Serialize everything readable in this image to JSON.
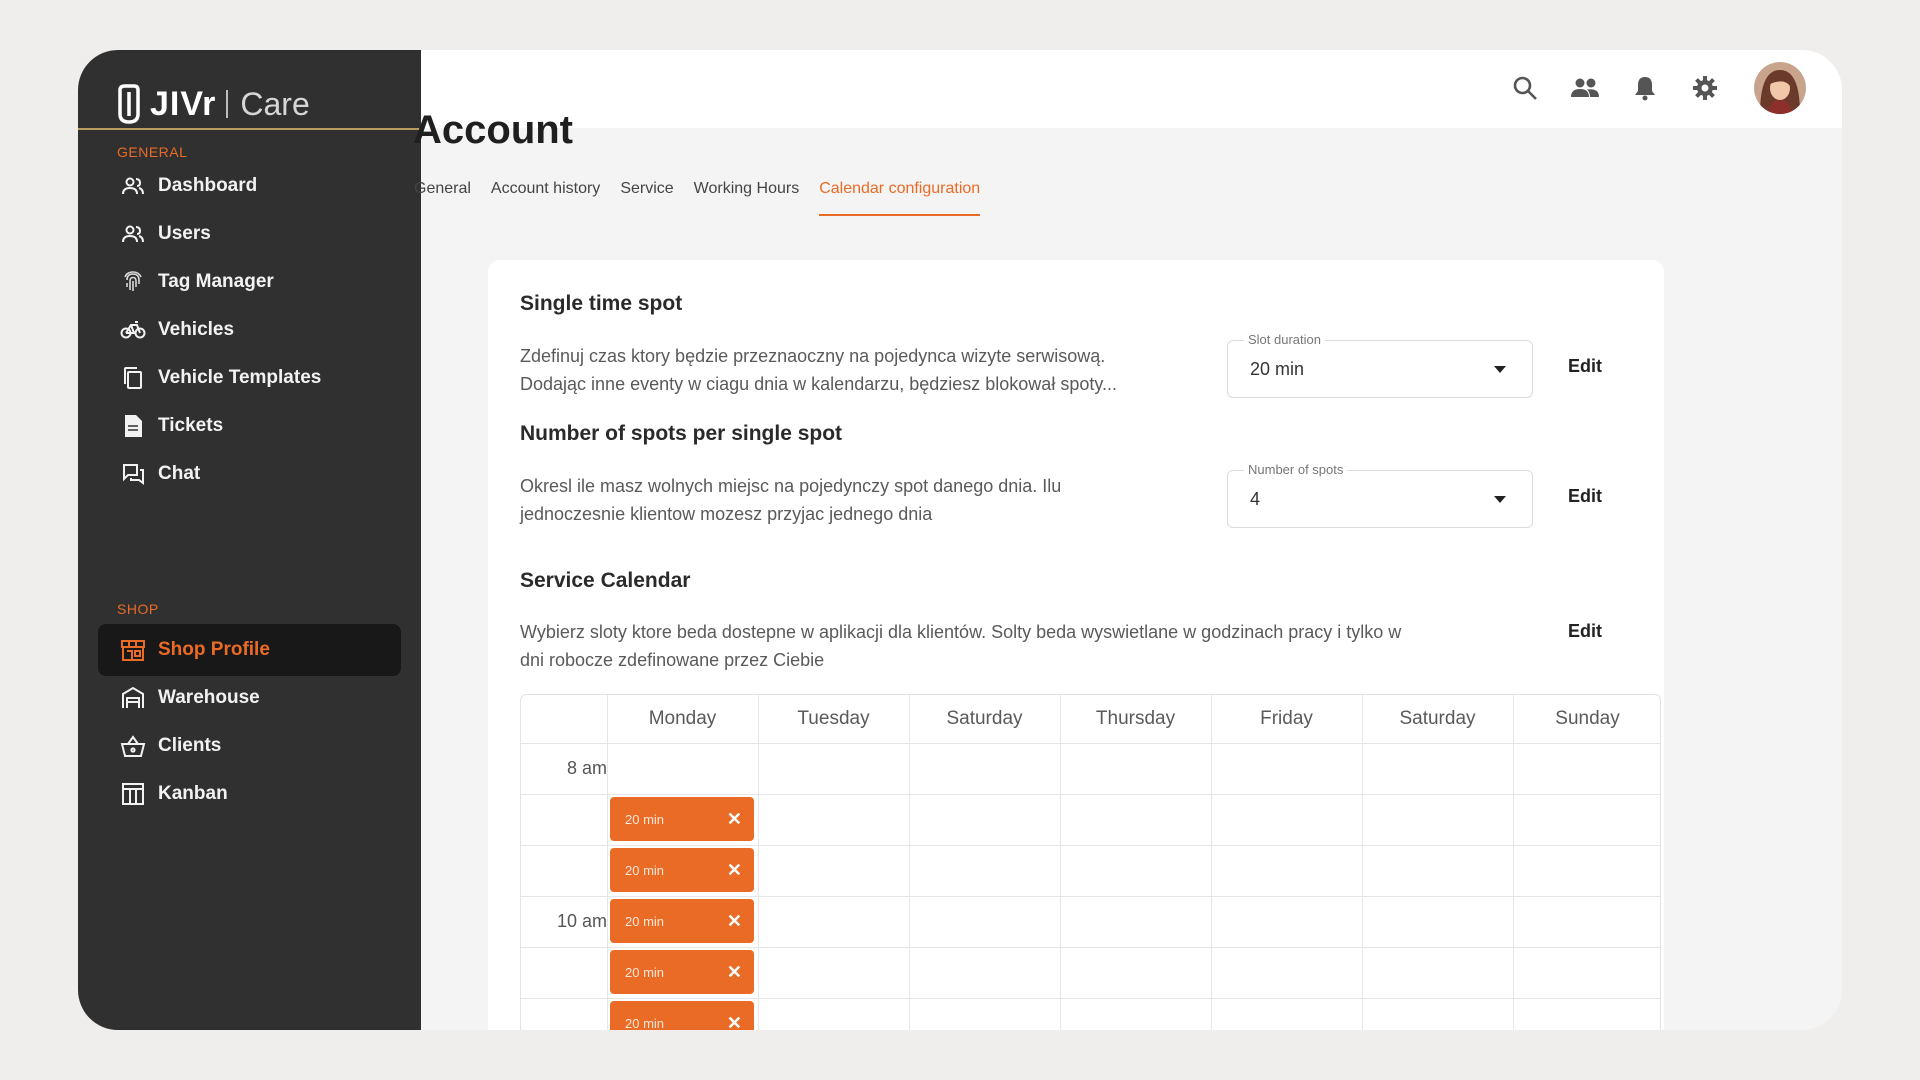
{
  "brand": {
    "name": "JIVr",
    "product": "Care"
  },
  "sidebar": {
    "general_label": "GENERAL",
    "shop_label": "SHOP",
    "general_items": [
      {
        "label": "Dashboard",
        "icon": "users-icon"
      },
      {
        "label": "Users",
        "icon": "users-icon"
      },
      {
        "label": "Tag Manager",
        "icon": "fingerprint-icon"
      },
      {
        "label": "Vehicles",
        "icon": "bicycle-icon"
      },
      {
        "label": "Vehicle Templates",
        "icon": "copy-icon"
      },
      {
        "label": "Tickets",
        "icon": "document-icon"
      },
      {
        "label": "Chat",
        "icon": "chat-icon"
      }
    ],
    "shop_items": [
      {
        "label": "Shop Profile",
        "icon": "store-icon",
        "active": true
      },
      {
        "label": "Warehouse",
        "icon": "warehouse-icon"
      },
      {
        "label": "Clients",
        "icon": "basket-icon"
      },
      {
        "label": "Kanban",
        "icon": "kanban-icon"
      }
    ]
  },
  "topbar": {
    "icons": [
      "search-icon",
      "people-icon",
      "bell-icon",
      "settings-icon",
      "avatar"
    ]
  },
  "page": {
    "title": "Account",
    "tabs": [
      "General",
      "Account history",
      "Service",
      "Working Hours",
      "Calendar configuration"
    ],
    "active_tab": "Calendar configuration"
  },
  "sections": {
    "single_spot": {
      "title": "Single time spot",
      "desc_line1": "Zdefinuj czas ktory będzie przeznaoczny na pojedynca wizyte serwisową.",
      "desc_line2": "Dodając inne eventy w ciagu dnia w kalendarzu, będziesz blokował spoty...",
      "field_label": "Slot duration",
      "field_value": "20 min",
      "edit": "Edit"
    },
    "spots_per": {
      "title": "Number of spots per single spot",
      "desc_line1": "Okresl ile masz wolnych miejsc na pojedynczy spot danego dnia. Ilu",
      "desc_line2": "jednoczesnie klientow mozesz przyjac jednego dnia",
      "field_label": "Number of spots",
      "field_value": "4",
      "edit": "Edit"
    },
    "service_calendar": {
      "title": "Service Calendar",
      "desc_line1": "Wybierz sloty ktore beda dostepne w aplikacji dla klientów. Solty beda wyswietlane w godzinach pracy i tylko w",
      "desc_line2": "dni robocze zdefinowane przez Ciebie",
      "edit": "Edit"
    }
  },
  "calendar": {
    "days": [
      "Monday",
      "Tuesday",
      "Saturday",
      "Thursday",
      "Friday",
      "Saturday",
      "Sunday"
    ],
    "time_labels": {
      "row0": "8 am",
      "row3": "10 am"
    },
    "slots": [
      "20 min",
      "20 min",
      "20 min",
      "20 min",
      "20 min"
    ],
    "slot_remove": "✕"
  },
  "colors": {
    "accent": "#ea6b25",
    "sidebar_bg": "#303030",
    "active_bg": "#181818"
  }
}
